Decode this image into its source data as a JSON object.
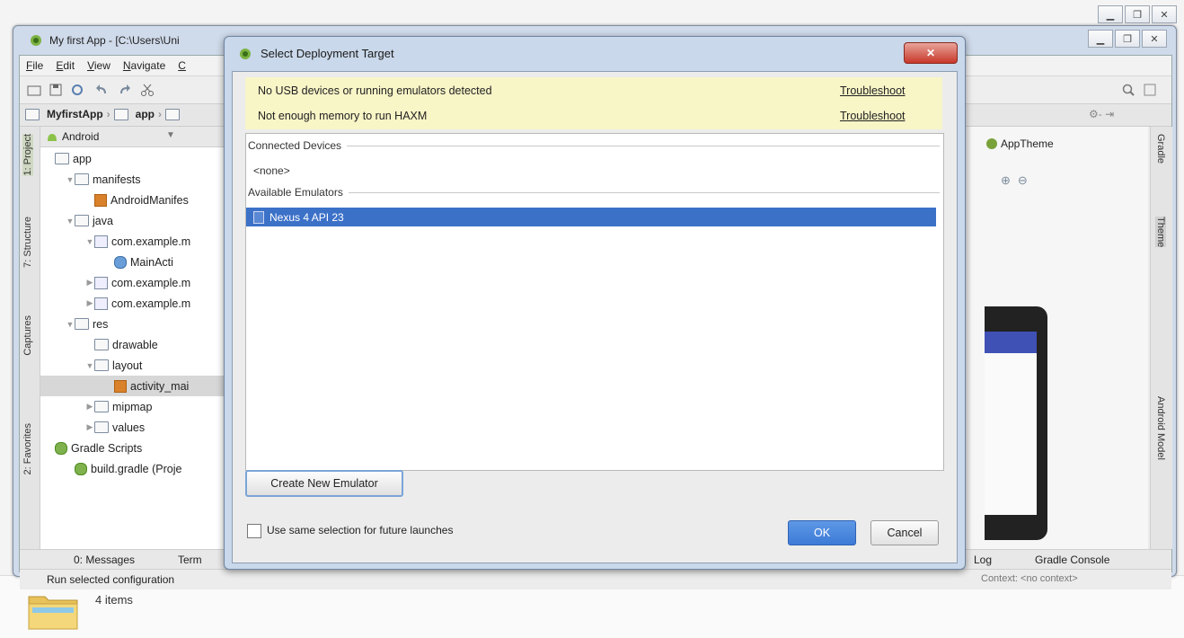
{
  "explorer": {
    "items_count": "4 items"
  },
  "window": {
    "title": "My first App - [C:\\Users\\Uni"
  },
  "menu": [
    {
      "prefix": "",
      "ul": "F",
      "rest": "ile"
    },
    {
      "prefix": "",
      "ul": "E",
      "rest": "dit"
    },
    {
      "prefix": "",
      "ul": "V",
      "rest": "iew"
    },
    {
      "prefix": "",
      "ul": "N",
      "rest": "avigate"
    },
    {
      "prefix": "",
      "ul": "C",
      "rest": ""
    }
  ],
  "breadcrumb": {
    "project": "MyfirstApp",
    "module": "app"
  },
  "project_panel": {
    "view": "Android",
    "tree": [
      {
        "label": "app",
        "indent": 0,
        "icon": "folder",
        "tri": ""
      },
      {
        "label": "manifests",
        "indent": 1,
        "icon": "folder",
        "tri": "▼"
      },
      {
        "label": "AndroidManifes",
        "indent": 2,
        "icon": "xml",
        "tri": ""
      },
      {
        "label": "java",
        "indent": 1,
        "icon": "folder",
        "tri": "▼"
      },
      {
        "label": "com.example.m",
        "indent": 2,
        "icon": "pkg",
        "tri": "▼"
      },
      {
        "label": "MainActi",
        "indent": 3,
        "icon": "class",
        "tri": ""
      },
      {
        "label": "com.example.m",
        "indent": 2,
        "icon": "pkg",
        "tri": "▶"
      },
      {
        "label": "com.example.m",
        "indent": 2,
        "icon": "pkg",
        "tri": "▶"
      },
      {
        "label": "res",
        "indent": 1,
        "icon": "folder",
        "tri": "▼"
      },
      {
        "label": "drawable",
        "indent": 2,
        "icon": "folder",
        "tri": ""
      },
      {
        "label": "layout",
        "indent": 2,
        "icon": "folder",
        "tri": "▼"
      },
      {
        "label": "activity_mai",
        "indent": 3,
        "icon": "xml",
        "tri": "",
        "selected": true
      },
      {
        "label": "mipmap",
        "indent": 2,
        "icon": "folder",
        "tri": "▶"
      },
      {
        "label": "values",
        "indent": 2,
        "icon": "folder",
        "tri": "▶"
      },
      {
        "label": "Gradle Scripts",
        "indent": 0,
        "icon": "gradle",
        "tri": ""
      },
      {
        "label": "build.gradle (Proje",
        "indent": 1,
        "icon": "gradle",
        "tri": ""
      }
    ]
  },
  "left_tool_tabs": {
    "project": "1: Project",
    "structure": "7: Structure",
    "captures": "Captures",
    "favorites": "2: Favorites"
  },
  "right_tool_tabs": {
    "gradle": "Gradle",
    "theme": "Theme",
    "android_model": "Android Model"
  },
  "editor": {
    "theme_label": "AppTheme"
  },
  "bottom_tabs": {
    "messages": "0: Messages",
    "terminal": "Term",
    "log": "Log",
    "gradle_console": "Gradle Console"
  },
  "status": {
    "text": "Run selected configuration",
    "context": "Context: <no context>"
  },
  "dialog": {
    "title": "Select Deployment Target",
    "close_label": "✕",
    "warnings": [
      {
        "text": "No USB devices or running emulators detected",
        "link": "Troubleshoot"
      },
      {
        "text": "Not enough memory to run HAXM",
        "link": "Troubleshoot"
      }
    ],
    "connected_header": "Connected Devices",
    "connected_none": "<none>",
    "emulators_header": "Available Emulators",
    "emulators": [
      "Nexus 4 API 23"
    ],
    "create_button": "Create New Emulator",
    "checkbox_label": "Use same selection for future launches",
    "checkbox_checked": false,
    "ok": "OK",
    "cancel": "Cancel"
  }
}
